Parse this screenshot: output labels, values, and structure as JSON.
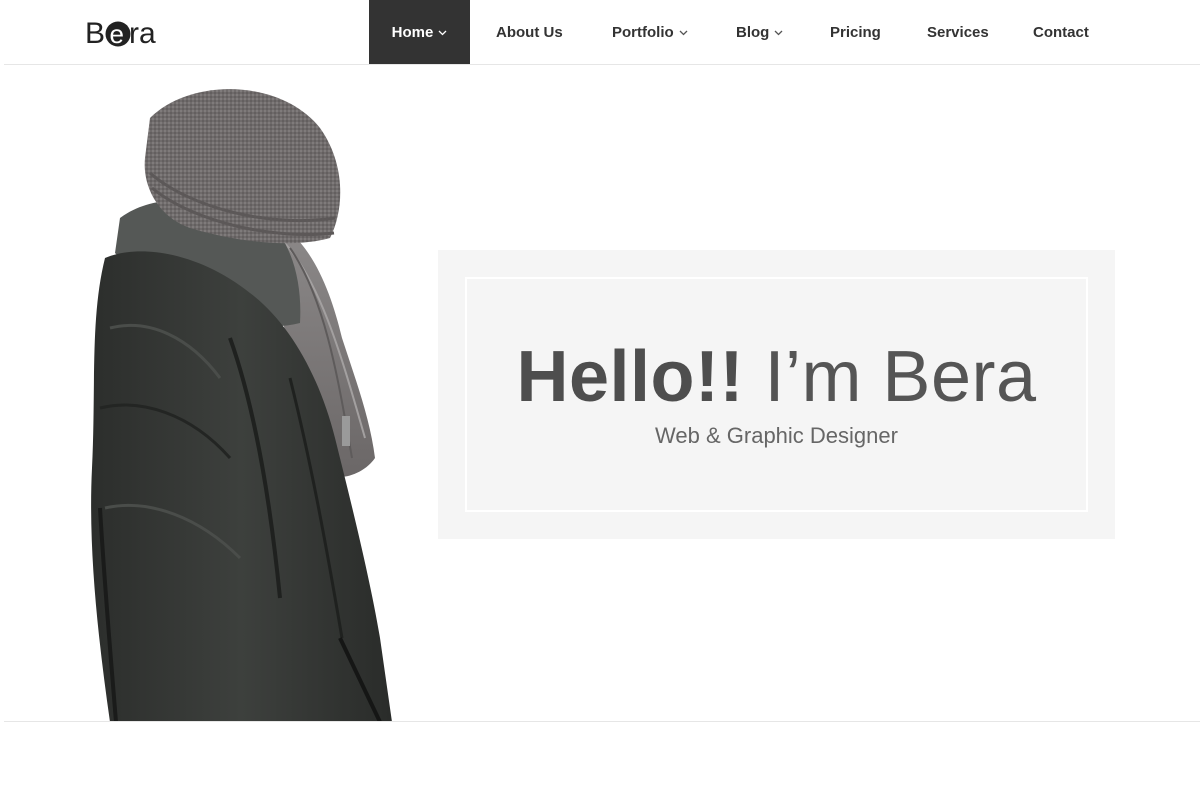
{
  "brand": {
    "logo_text": "Bera"
  },
  "nav": {
    "items": [
      {
        "label": "Home",
        "has_dropdown": true,
        "active": true
      },
      {
        "label": "About Us",
        "has_dropdown": false,
        "active": false
      },
      {
        "label": "Portfolio",
        "has_dropdown": true,
        "active": false
      },
      {
        "label": "Blog",
        "has_dropdown": true,
        "active": false
      },
      {
        "label": "Pricing",
        "has_dropdown": false,
        "active": false
      },
      {
        "label": "Services",
        "has_dropdown": false,
        "active": false
      },
      {
        "label": "Contact",
        "has_dropdown": false,
        "active": false
      }
    ]
  },
  "hero": {
    "greeting": "Hello!!",
    "intro": "I’m Bera",
    "tagline": "Web & Graphic Designer"
  },
  "colors": {
    "nav_active_bg": "#333333",
    "card_bg": "#f5f5f5",
    "headline": "#4e4e4e"
  }
}
